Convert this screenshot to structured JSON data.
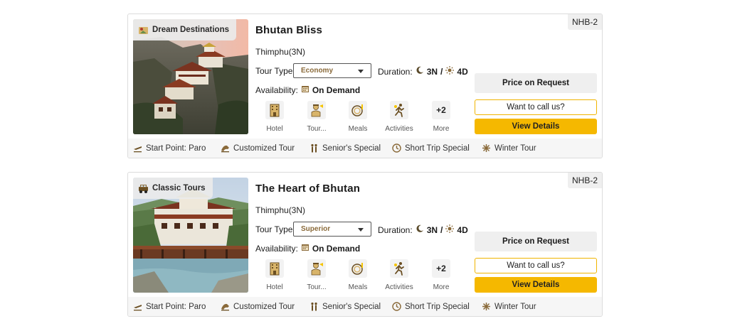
{
  "colors": {
    "accent": "#f5b800",
    "accent_border": "#f0b400",
    "tour_type_text": "#8a6a3a"
  },
  "cards": [
    {
      "code": "NHB-2",
      "category": "Dream Destinations",
      "category_icon": "map-pin-icon",
      "title": "Bhutan Bliss",
      "city": "Thimphu(3N)",
      "tour_type_label": "Tour Type",
      "tour_type_value": "Economy",
      "duration_label": "Duration:",
      "nights": "3N",
      "separator": "/",
      "days": "4D",
      "availability_label": "Availability:",
      "availability_value": "On Demand",
      "amenities": [
        {
          "icon": "hotel-icon",
          "label": "Hotel"
        },
        {
          "icon": "tour-guide-icon",
          "label": "Tour..."
        },
        {
          "icon": "meals-icon",
          "label": "Meals"
        },
        {
          "icon": "activities-icon",
          "label": "Activities"
        },
        {
          "icon": "more-icon",
          "label": "More",
          "count": "+2"
        }
      ],
      "price": "Price on Request",
      "call_label": "Want to call us?",
      "view_label": "View Details",
      "tags": [
        {
          "icon": "plane-icon",
          "label": "Start Point: Paro"
        },
        {
          "icon": "customized-tour-icon",
          "label": "Customized Tour"
        },
        {
          "icon": "senior-icon",
          "label": "Senior's Special"
        },
        {
          "icon": "short-trip-icon",
          "label": "Short Trip Special"
        },
        {
          "icon": "snowflake-icon",
          "label": "Winter Tour"
        }
      ]
    },
    {
      "code": "NHB-2",
      "category": "Classic Tours",
      "category_icon": "jeep-icon",
      "title": "The Heart of Bhutan",
      "city": "Thimphu(3N)",
      "tour_type_label": "Tour Type",
      "tour_type_value": "Superior",
      "duration_label": "Duration:",
      "nights": "3N",
      "separator": "/",
      "days": "4D",
      "availability_label": "Availability:",
      "availability_value": "On Demand",
      "amenities": [
        {
          "icon": "hotel-icon",
          "label": "Hotel"
        },
        {
          "icon": "tour-guide-icon",
          "label": "Tour..."
        },
        {
          "icon": "meals-icon",
          "label": "Meals"
        },
        {
          "icon": "activities-icon",
          "label": "Activities"
        },
        {
          "icon": "more-icon",
          "label": "More",
          "count": "+2"
        }
      ],
      "price": "Price on Request",
      "call_label": "Want to call us?",
      "view_label": "View Details",
      "tags": [
        {
          "icon": "plane-icon",
          "label": "Start Point: Paro"
        },
        {
          "icon": "customized-tour-icon",
          "label": "Customized Tour"
        },
        {
          "icon": "senior-icon",
          "label": "Senior's Special"
        },
        {
          "icon": "short-trip-icon",
          "label": "Short Trip Special"
        },
        {
          "icon": "snowflake-icon",
          "label": "Winter Tour"
        }
      ]
    }
  ]
}
